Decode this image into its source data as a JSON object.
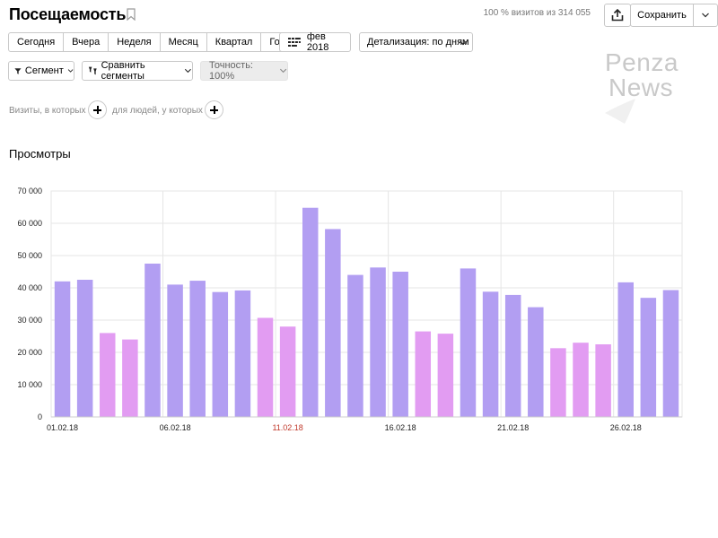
{
  "header": {
    "title": "Посещаемость",
    "visits_info": "100 % визитов из 314 055",
    "save_label": "Сохранить"
  },
  "period": {
    "items": [
      "Сегодня",
      "Вчера",
      "Неделя",
      "Месяц",
      "Квартал",
      "Год"
    ],
    "date_label": "фев 2018",
    "detail_label": "Детализация: по дням"
  },
  "segments": {
    "segment_label": "Сегмент",
    "compare_label": "Сравнить сегменты",
    "accuracy_label": "Точность: 100%"
  },
  "filters": {
    "visits_label": "Визиты, в которых",
    "people_label": "для людей, у которых"
  },
  "section_title": "Просмотры",
  "watermark": {
    "line1": "Penza",
    "line2": "News"
  },
  "colors": {
    "weekday_bar": "#b29ef2",
    "weekend_bar": "#e29cf2",
    "grid": "#e6e6e6",
    "holiday_tick": "#c0392b"
  },
  "chart_data": {
    "type": "bar",
    "categories": [
      "01.02.18",
      "02.02.18",
      "03.02.18",
      "04.02.18",
      "05.02.18",
      "06.02.18",
      "07.02.18",
      "08.02.18",
      "09.02.18",
      "10.02.18",
      "11.02.18",
      "12.02.18",
      "13.02.18",
      "14.02.18",
      "15.02.18",
      "16.02.18",
      "17.02.18",
      "18.02.18",
      "19.02.18",
      "20.02.18",
      "21.02.18",
      "22.02.18",
      "23.02.18",
      "24.02.18",
      "25.02.18",
      "26.02.18",
      "27.02.18",
      "28.02.18"
    ],
    "values": [
      42000,
      42500,
      26000,
      24000,
      47500,
      41000,
      42200,
      38700,
      39200,
      30700,
      28000,
      64800,
      58200,
      44000,
      46300,
      45000,
      26500,
      25800,
      46000,
      38800,
      37800,
      34000,
      21300,
      23000,
      22500,
      41700,
      36900,
      39300
    ],
    "weekend": [
      false,
      false,
      true,
      true,
      false,
      false,
      false,
      false,
      false,
      true,
      true,
      false,
      false,
      false,
      false,
      false,
      true,
      true,
      false,
      false,
      false,
      false,
      true,
      true,
      true,
      false,
      false,
      false
    ],
    "x_tick_labels": [
      {
        "index": 0,
        "label": "01.02.18",
        "holiday": false
      },
      {
        "index": 5,
        "label": "06.02.18",
        "holiday": false
      },
      {
        "index": 10,
        "label": "11.02.18",
        "holiday": true
      },
      {
        "index": 15,
        "label": "16.02.18",
        "holiday": false
      },
      {
        "index": 20,
        "label": "21.02.18",
        "holiday": false
      },
      {
        "index": 25,
        "label": "26.02.18",
        "holiday": false
      }
    ],
    "y_ticks": [
      0,
      10000,
      20000,
      30000,
      40000,
      50000,
      60000,
      70000
    ],
    "y_tick_labels": [
      "0",
      "10 000",
      "20 000",
      "30 000",
      "40 000",
      "50 000",
      "60 000",
      "70 000"
    ],
    "ylim": [
      0,
      70000
    ],
    "title": "Просмотры",
    "grid": true
  }
}
